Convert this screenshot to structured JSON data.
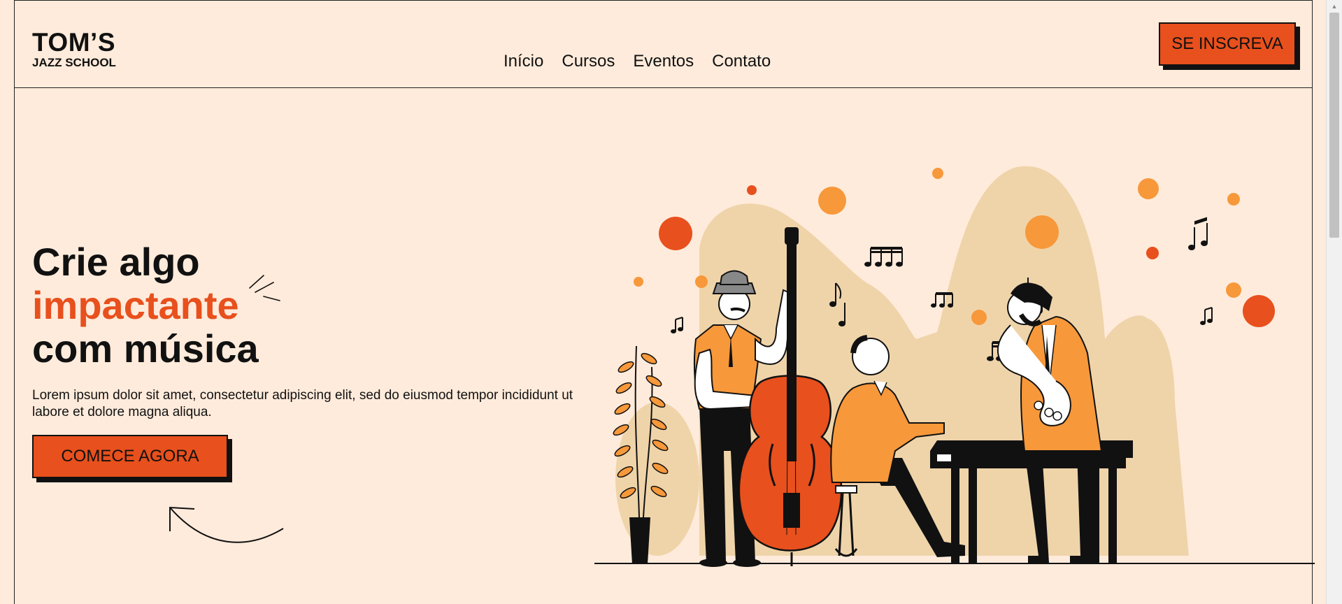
{
  "header": {
    "logo_title": "TOM’S",
    "logo_subtitle": "JAZZ SCHOOL",
    "nav": [
      "Início",
      "Cursos",
      "Eventos",
      "Contato"
    ],
    "signup_label": "SE INSCREVA"
  },
  "hero": {
    "title_line1": "Crie algo",
    "title_line2": "impactante",
    "title_line3": "com música",
    "description": "Lorem ipsum dolor sit amet, consectetur adipiscing elit, sed do eiusmod tempor incididunt ut labore et dolore magna aliqua.",
    "cta_label": "COMECE AGORA"
  },
  "colors": {
    "background": "#ffebdb",
    "accent": "#e8501d",
    "accent_light": "#f7983a",
    "blob": "#efd4aa"
  },
  "icons": [
    "sparkle-lines-icon",
    "curved-arrow-icon",
    "jazz-band-illustration"
  ]
}
